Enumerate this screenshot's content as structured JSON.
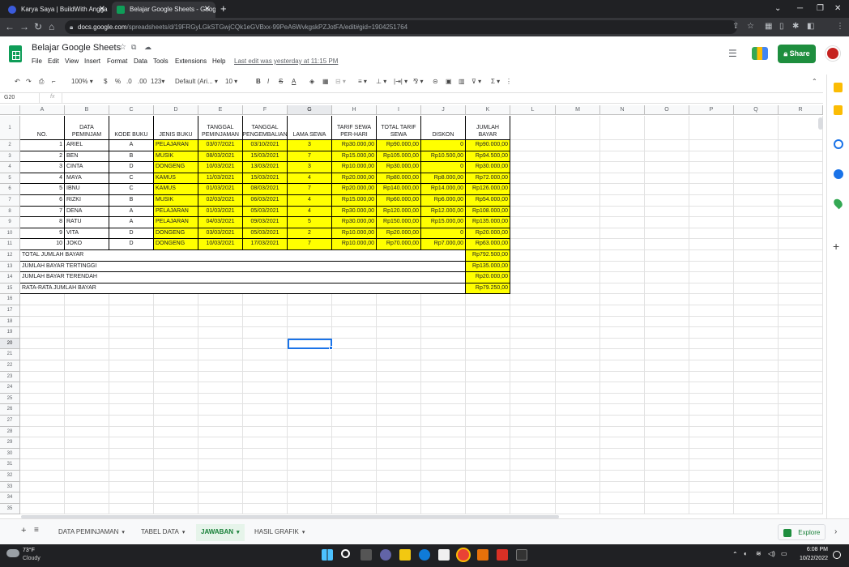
{
  "browser": {
    "tabs": [
      {
        "label": "Karya Saya | BuildWith Angga",
        "active": false
      },
      {
        "label": "Belajar Google Sheets - Google S",
        "active": true
      }
    ],
    "url_domain": "docs.google.com",
    "url_rest": "/spreadsheets/d/19FRGyLGkSTGwjCQk1eGVBxx-99PeA6WvkgskPZJotFA/edit#gid=1904251764"
  },
  "doc": {
    "title": "Belajar Google Sheets",
    "menu": [
      "File",
      "Edit",
      "View",
      "Insert",
      "Format",
      "Data",
      "Tools",
      "Extensions",
      "Help"
    ],
    "last_edit": "Last edit was yesterday at 11:15 PM",
    "share_label": "Share"
  },
  "toolbar": {
    "zoom": "100%",
    "currency": "$",
    "percent": "%",
    "dec_less": ".0",
    "dec_more": ".00",
    "format": "123",
    "font": "Default (Ari...",
    "size": "10"
  },
  "formula_bar": {
    "cell_ref": "G20",
    "fx": "fx"
  },
  "columns": [
    "A",
    "B",
    "C",
    "D",
    "E",
    "F",
    "G",
    "H",
    "I",
    "J",
    "K",
    "L",
    "M",
    "N",
    "O",
    "P",
    "Q",
    "R"
  ],
  "header": [
    "NO.",
    "DATA PEMINJAM",
    "KODE BUKU",
    "JENIS BUKU",
    "TANGGAL PEMINJAMAN",
    "TANGGAL PENGEMBALIAN",
    "LAMA SEWA",
    "TARIF SEWA PER-HARI",
    "TOTAL TARIF SEWA",
    "DISKON",
    "JUMLAH BAYAR"
  ],
  "rows": [
    [
      "1",
      "ARIEL",
      "A",
      "PELAJARAN",
      "03/07/2021",
      "03/10/2021",
      "3",
      "Rp30.000,00",
      "Rp90.000,00",
      "0",
      "Rp90.000,00"
    ],
    [
      "2",
      "BEN",
      "B",
      "MUSIK",
      "08/03/2021",
      "15/03/2021",
      "7",
      "Rp15.000,00",
      "Rp105.000,00",
      "Rp10.500,00",
      "Rp94.500,00"
    ],
    [
      "3",
      "CINTA",
      "D",
      "DONGENG",
      "10/03/2021",
      "13/03/2021",
      "3",
      "Rp10.000,00",
      "Rp30.000,00",
      "0",
      "Rp30.000,00"
    ],
    [
      "4",
      "MAYA",
      "C",
      "KAMUS",
      "11/03/2021",
      "15/03/2021",
      "4",
      "Rp20.000,00",
      "Rp80.000,00",
      "Rp8.000,00",
      "Rp72.000,00"
    ],
    [
      "5",
      "IBNU",
      "C",
      "KAMUS",
      "01/03/2021",
      "08/03/2021",
      "7",
      "Rp20.000,00",
      "Rp140.000,00",
      "Rp14.000,00",
      "Rp126.000,00"
    ],
    [
      "6",
      "RIZKI",
      "B",
      "MUSIK",
      "02/03/2021",
      "06/03/2021",
      "4",
      "Rp15.000,00",
      "Rp60.000,00",
      "Rp6.000,00",
      "Rp54.000,00"
    ],
    [
      "7",
      "DENA",
      "A",
      "PELAJARAN",
      "01/03/2021",
      "05/03/2021",
      "4",
      "Rp30.000,00",
      "Rp120.000,00",
      "Rp12.000,00",
      "Rp108.000,00"
    ],
    [
      "8",
      "RATU",
      "A",
      "PELAJARAN",
      "04/03/2021",
      "09/03/2021",
      "5",
      "Rp30.000,00",
      "Rp150.000,00",
      "Rp15.000,00",
      "Rp135.000,00"
    ],
    [
      "9",
      "VITA",
      "D",
      "DONGENG",
      "03/03/2021",
      "05/03/2021",
      "2",
      "Rp10.000,00",
      "Rp20.000,00",
      "0",
      "Rp20.000,00"
    ],
    [
      "10",
      "JOKO",
      "D",
      "DONGENG",
      "10/03/2021",
      "17/03/2021",
      "7",
      "Rp10.000,00",
      "Rp70.000,00",
      "Rp7.000,00",
      "Rp63.000,00"
    ]
  ],
  "summary": [
    {
      "label": "TOTAL JUMLAH BAYAR",
      "value": "Rp792.500,00"
    },
    {
      "label": "JUMLAH BAYAR TERTINGGI",
      "value": "Rp135.000,00"
    },
    {
      "label": "JUMLAH BAYAR TERENDAH",
      "value": "Rp20.000,00"
    },
    {
      "label": "RATA-RATA JUMLAH BAYAR",
      "value": "Rp79.250,00"
    }
  ],
  "sheets": [
    {
      "label": "DATA PEMINJAMAN",
      "active": false
    },
    {
      "label": "TABEL DATA",
      "active": false
    },
    {
      "label": "JAWABAN",
      "active": true
    },
    {
      "label": "HASIL GRAFIK",
      "active": false
    }
  ],
  "explore_label": "Explore",
  "taskbar": {
    "weather_temp": "73°F",
    "weather_desc": "Cloudy",
    "time": "6:08 PM",
    "date": "10/22/2022"
  },
  "colors": {
    "highlight": "#ffff00",
    "sheets_green": "#0f9d58",
    "share_green": "#1e8e3e"
  }
}
